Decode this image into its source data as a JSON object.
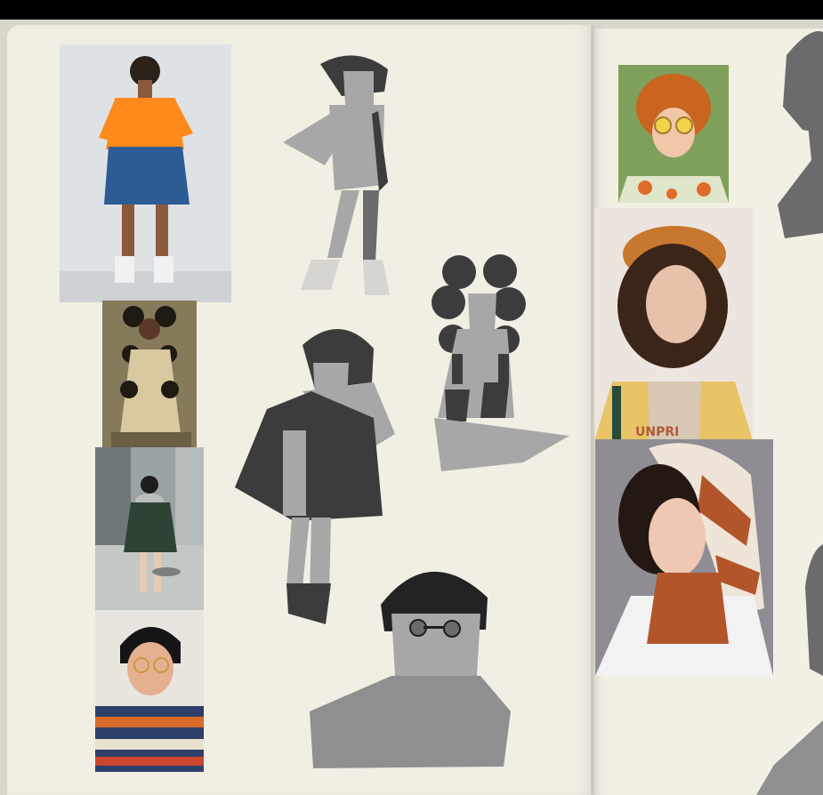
{
  "scene": {
    "colors": {
      "background": "#000000",
      "page": "#f1eee3",
      "silhouette_dark": "#3c3c3c",
      "silhouette_mid": "#6b6b6b",
      "silhouette_light": "#a7a7a7"
    }
  },
  "photos": {
    "orange_turtleneck": {
      "colors": {
        "top": "#ff8a1c",
        "skirt": "#2d5b94",
        "bg": "#dfe2e4"
      }
    },
    "puff_hair_dress": {
      "colors": {
        "dress": "#d8c9a0",
        "bg": "#857a5a"
      }
    },
    "street_coat": {
      "colors": {
        "coat": "#2f4334",
        "bg": "#9aa3a3"
      }
    },
    "glasses_sweater": {
      "colors": {
        "sweater": "#d86a2a",
        "bg": "#e8e5de"
      }
    },
    "curly_glasses_green": {
      "colors": {
        "hair": "#c9651f",
        "bg": "#7fa05a"
      }
    },
    "knit_hat_jacket": {
      "colors": {
        "hat": "#c7772e",
        "jacket": "#e8c466",
        "bg": "#ece5df"
      }
    },
    "headscarf": {
      "colors": {
        "scarf": "#b2552b",
        "shirt": "#f2f2f2",
        "bg": "#8f8d93"
      }
    }
  },
  "labels": {
    "jacket_print": "UNPRI"
  }
}
